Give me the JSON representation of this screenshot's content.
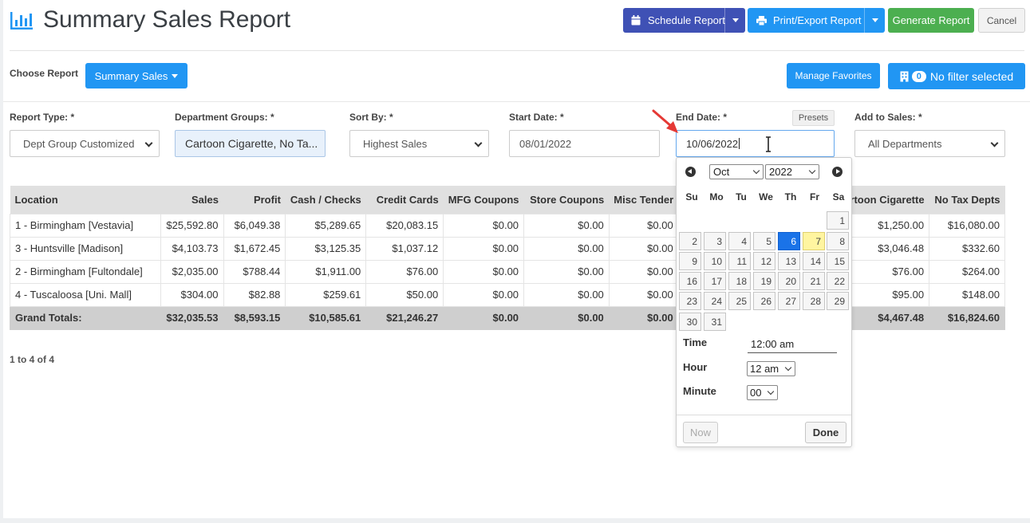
{
  "header": {
    "title": "Summary Sales Report",
    "buttons": {
      "schedule": "Schedule Report",
      "print": "Print/Export Report",
      "generate": "Generate Report",
      "cancel": "Cancel"
    }
  },
  "choose": {
    "label": "Choose Report",
    "selected": "Summary Sales",
    "manage_favorites": "Manage Favorites",
    "filter_count": "0",
    "filter_text": "No filter selected"
  },
  "filters": {
    "report_type": {
      "label": "Report Type: *",
      "value": "Dept Group Customized"
    },
    "department_groups": {
      "label": "Department Groups: *",
      "value": "Cartoon Cigarette, No Ta..."
    },
    "sort_by": {
      "label": "Sort By: *",
      "value": "Highest Sales"
    },
    "start_date": {
      "label": "Start Date: *",
      "value": "08/01/2022"
    },
    "end_date": {
      "label": "End Date: *",
      "value": "10/06/2022",
      "presets": "Presets"
    },
    "add_to_sales": {
      "label": "Add to Sales: *",
      "value": "All Departments"
    }
  },
  "table": {
    "columns": [
      "Location",
      "Sales",
      "Profit",
      "Cash / Checks",
      "Credit Cards",
      "MFG Coupons",
      "Store Coupons",
      "Misc Tender",
      "",
      "artoon Cigarette",
      "No Tax Depts"
    ],
    "rows": [
      [
        "1 - Birmingham [Vestavia]",
        "$25,592.80",
        "$6,049.38",
        "$5,289.65",
        "$20,083.15",
        "$0.00",
        "$0.00",
        "$0.00",
        "",
        "$1,250.00",
        "$16,080.00"
      ],
      [
        "3 - Huntsville [Madison]",
        "$4,103.73",
        "$1,672.45",
        "$3,125.35",
        "$1,037.12",
        "$0.00",
        "$0.00",
        "$0.00",
        "",
        "$3,046.48",
        "$332.60"
      ],
      [
        "2 - Birmingham [Fultondale]",
        "$2,035.00",
        "$788.44",
        "$1,911.00",
        "$76.00",
        "$0.00",
        "$0.00",
        "$0.00",
        "",
        "$76.00",
        "$264.00"
      ],
      [
        "4 - Tuscaloosa [Uni. Mall]",
        "$304.00",
        "$82.88",
        "$259.61",
        "$50.00",
        "$0.00",
        "$0.00",
        "$0.00",
        "",
        "$95.00",
        "$148.00"
      ]
    ],
    "totals": [
      "Grand Totals:",
      "$32,035.53",
      "$8,593.15",
      "$10,585.61",
      "$21,246.27",
      "$0.00",
      "$0.00",
      "$0.00",
      "",
      "$4,467.48",
      "$16,824.60"
    ],
    "pager": "1 to 4 of 4"
  },
  "datepicker": {
    "month": "Oct",
    "year": "2022",
    "weekdays": [
      "Su",
      "Mo",
      "Tu",
      "We",
      "Th",
      "Fr",
      "Sa"
    ],
    "days": [
      "1",
      "2",
      "3",
      "4",
      "5",
      "6",
      "7",
      "8",
      "9",
      "10",
      "11",
      "12",
      "13",
      "14",
      "15",
      "16",
      "17",
      "18",
      "19",
      "20",
      "21",
      "22",
      "23",
      "24",
      "25",
      "26",
      "27",
      "28",
      "29",
      "30",
      "31"
    ],
    "selected_day": "6",
    "today_day": "7",
    "time_label": "Time",
    "time_value": "12:00 am",
    "hour_label": "Hour",
    "hour_value": "12 am",
    "minute_label": "Minute",
    "minute_value": "00",
    "now": "Now",
    "done": "Done"
  },
  "colors": {
    "primary": "#2196f3",
    "indigo": "#3f51b5",
    "success": "#4caf50",
    "selected_day": "#1a73e8",
    "today": "#fff5a0",
    "arrow": "#e53935"
  },
  "icons": [
    "bar-chart-icon",
    "calendar-icon",
    "printer-icon",
    "building-icon",
    "chevron-down-icon",
    "arrow-left-icon",
    "arrow-right-icon",
    "text-cursor-icon"
  ]
}
